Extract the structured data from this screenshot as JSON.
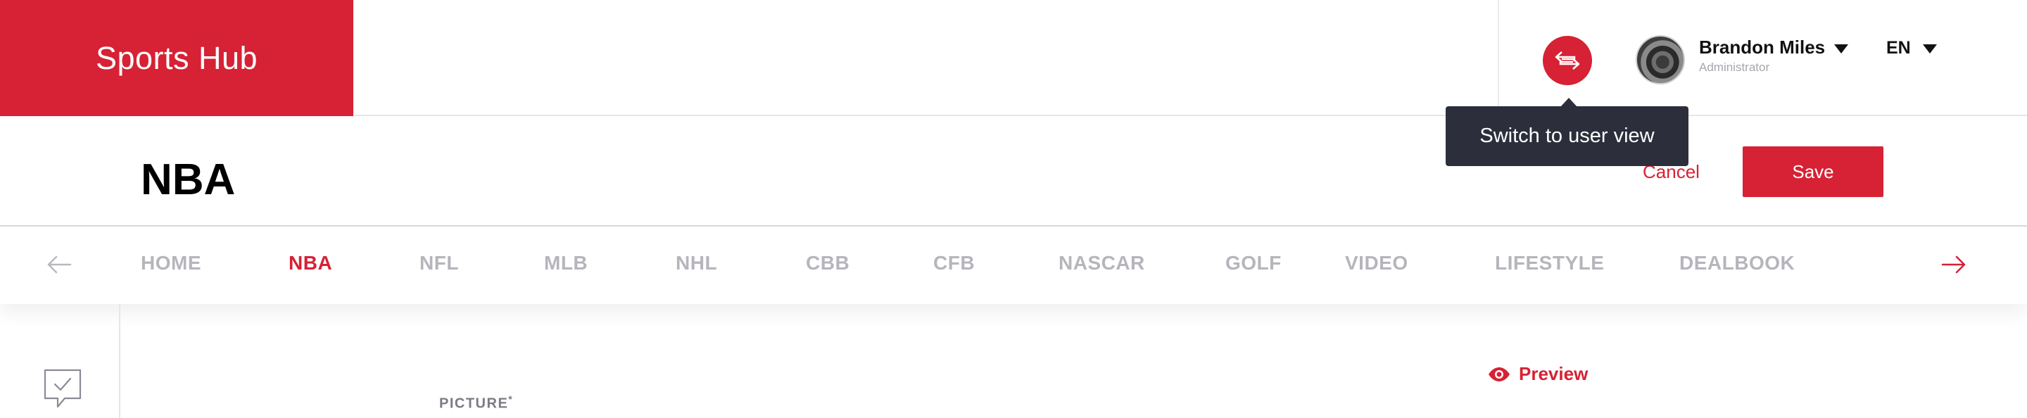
{
  "brand": {
    "title": "Sports Hub",
    "color": "#d72134"
  },
  "header": {
    "switch_icon": "swap-arrows-icon",
    "user": {
      "name": "Brandon Miles",
      "role": "Administrator"
    },
    "language": "EN",
    "tooltip": "Switch to user view"
  },
  "page": {
    "title": "NBA",
    "cancel_label": "Cancel",
    "save_label": "Save"
  },
  "nav": {
    "items": [
      "HOME",
      "NBA",
      "NFL",
      "MLB",
      "NHL",
      "CBB",
      "CFB",
      "NASCAR",
      "GOLF",
      "VIDEO",
      "LIFESTYLE",
      "DEALBOOK"
    ],
    "active": "NBA",
    "prev_icon": "arrow-left-icon",
    "next_icon": "arrow-right-icon"
  },
  "content": {
    "picture_label": "PICTURE",
    "required_mark": "*",
    "preview_label": "Preview",
    "preview_icon": "eye-icon",
    "rail_icon": "comment-check-icon"
  }
}
